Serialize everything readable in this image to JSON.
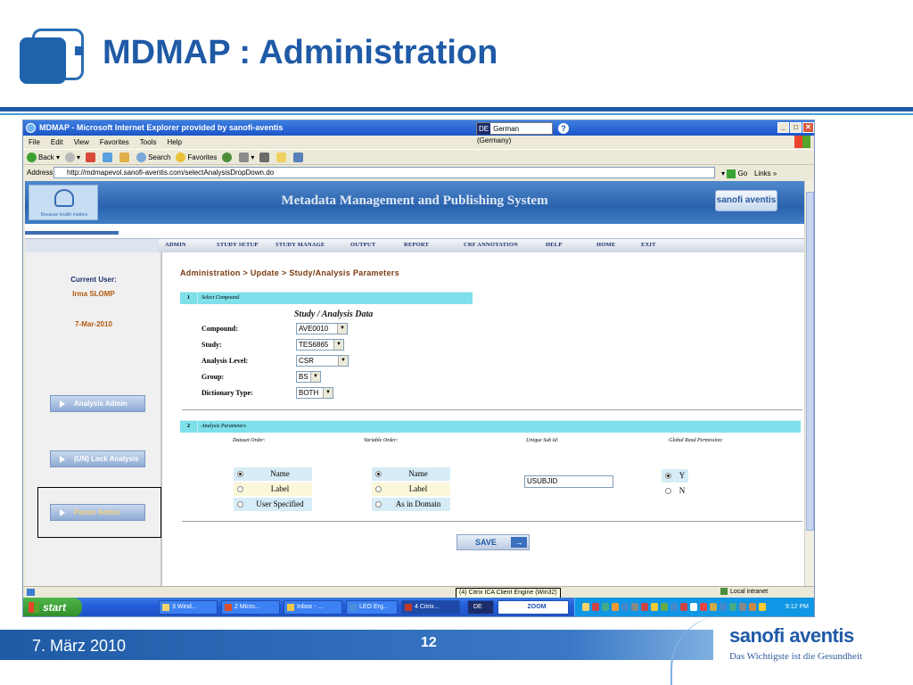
{
  "slide": {
    "title": "MDMAP : Administration",
    "date": "7. März 2010",
    "page_number": "12",
    "brand": "sanofi aventis",
    "tagline": "Das Wichtigste ist die Gesundheit"
  },
  "browser": {
    "window_title": "MDMAP - Microsoft Internet Explorer provided by sanofi-aventis",
    "language_code": "DE",
    "language_label": "German (Germany)",
    "menu": [
      "File",
      "Edit",
      "View",
      "Favorites",
      "Tools",
      "Help"
    ],
    "toolbar": {
      "back": "Back",
      "search": "Search",
      "favorites": "Favorites"
    },
    "address_label": "Address",
    "address_url": "http://mdmapevol.sanofi-aventis.com/selectAnalysisDropDown.do",
    "go_label": "Go",
    "links_label": "Links",
    "status_zone": "Local intranet",
    "status_popup": "(4) Citrix ICA Client Engine (Win32)"
  },
  "app": {
    "title": "Metadata Management and Publishing System",
    "left_logo_tagline": "Because health matters",
    "right_logo": "sanofi aventis",
    "nav": [
      "ADMIN",
      "STUDY SETUP",
      "STUDY MANAGE",
      "OUTPUT",
      "REPORT",
      "CRF ANNOTATION",
      "HELP",
      "HOME",
      "EXIT"
    ]
  },
  "sidebar": {
    "current_user_label": "Current User:",
    "user_name": "Irma  SLOMP",
    "date": "7-Mar-2010",
    "buttons": [
      "Analysis Admin",
      "(UN) Lock Analysis",
      "Param Admin"
    ]
  },
  "main": {
    "breadcrumb": "Administration > Update > Study/Analysis Parameters",
    "section1": {
      "number": "1",
      "label": "Select Compound"
    },
    "subtitle": "Study / Analysis Data",
    "fields": [
      {
        "label": "Compound:",
        "value": "AVE0010"
      },
      {
        "label": "Study:",
        "value": "TES6865"
      },
      {
        "label": "Analysis Level:",
        "value": "CSR"
      },
      {
        "label": "Group:",
        "value": "BS"
      },
      {
        "label": "Dictionary Type:",
        "value": "BOTH"
      }
    ],
    "section2": {
      "number": "2",
      "label": "Analysis Parameters"
    },
    "columns": [
      "Dataset Order:",
      "Variable Order:",
      "Unique Sub Id:",
      "Global Read Permission:"
    ],
    "dataset_order": [
      "Name",
      "Label",
      "User Specified"
    ],
    "variable_order": [
      "Name",
      "Label",
      "As in Domain"
    ],
    "unique_sub_id": "USUBJID",
    "global_read": [
      "Y",
      "N"
    ],
    "save_label": "SAVE"
  },
  "taskbar": {
    "start": "start",
    "tasks": [
      "3 Wind...",
      "2 Micro...",
      "Inbox - ...",
      "LEO Erg...",
      "4 Citrix...",
      "DE",
      "ZOOM"
    ],
    "clock": "9:12 PM"
  },
  "colors": {
    "slide_blue": "#1f5aa6",
    "section_bar": "#7ee0ea",
    "breadcrumb": "#7a3a10"
  }
}
